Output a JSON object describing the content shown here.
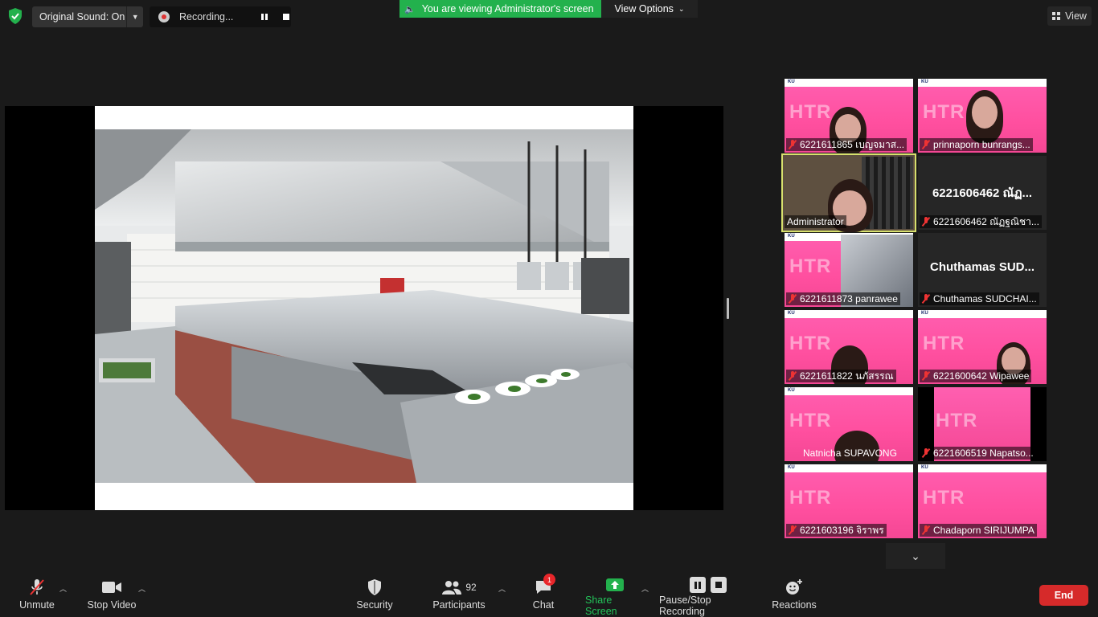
{
  "topbar": {
    "original_sound_label": "Original Sound: On",
    "recording_label": "Recording...",
    "viewing_banner": "You are viewing Administrator's screen",
    "view_options_label": "View Options",
    "view_label": "View"
  },
  "gallery": {
    "tiles": [
      {
        "name": "6221611865 เบญจมาส...",
        "type": "video",
        "mic_muted": true
      },
      {
        "name": "prinnaporn bunrangs...",
        "type": "video",
        "mic_muted": true
      },
      {
        "name": "Administrator",
        "type": "video",
        "mic_muted": false,
        "active_speaker": true
      },
      {
        "name": "6221606462 ณัฏฐณิชา...",
        "big_name": "6221606462 ณัฏ...",
        "type": "name-only",
        "mic_muted": true
      },
      {
        "name": "6221611873 panrawee",
        "type": "video",
        "mic_muted": true
      },
      {
        "name": "Chuthamas SUDCHAI...",
        "big_name": "Chuthamas SUD...",
        "type": "name-only",
        "mic_muted": true
      },
      {
        "name": "6221611822 นภัสรรณ",
        "type": "video",
        "mic_muted": true
      },
      {
        "name": "6221600642 Wipawee",
        "type": "video",
        "mic_muted": true
      },
      {
        "name": "Natnicha SUPAVONG",
        "type": "video",
        "mic_muted": false
      },
      {
        "name": "6221606519 Napatso...",
        "type": "video",
        "mic_muted": true
      },
      {
        "name": "6221603196 จิราพร",
        "type": "video",
        "mic_muted": true
      },
      {
        "name": "Chadaporn SIRIJUMPA",
        "type": "video",
        "mic_muted": true
      }
    ],
    "virtual_bg_text": "HTR"
  },
  "toolbar": {
    "unmute": "Unmute",
    "stop_video": "Stop Video",
    "security": "Security",
    "participants": "Participants",
    "participants_count": "92",
    "chat": "Chat",
    "chat_badge": "1",
    "share_screen": "Share Screen",
    "pause_stop_recording": "Pause/Stop Recording",
    "reactions": "Reactions",
    "end": "End"
  },
  "colors": {
    "banner_green": "#23b14d",
    "share_green": "#23b14d",
    "end_red": "#d62a2a",
    "active_speaker_border": "#d7e06d",
    "muted_red": "#e33333"
  }
}
